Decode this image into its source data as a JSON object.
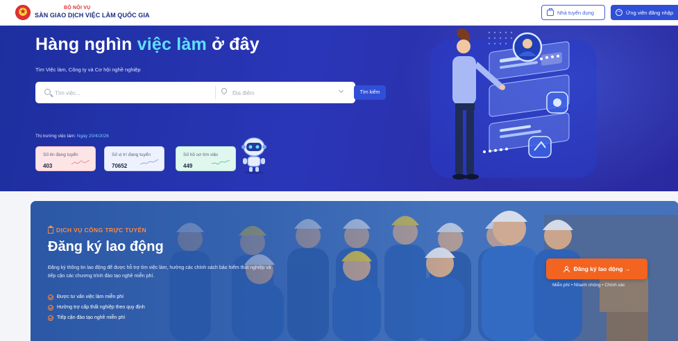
{
  "header": {
    "org_parent": "BỘ NỘI VỤ",
    "org_name": "SÀN GIAO DỊCH VIỆC LÀM QUỐC GIA",
    "employer_button": "Nhà tuyển dụng",
    "candidate_button": "Ứng viên đăng nhập"
  },
  "hero": {
    "title_prefix": "Hàng nghìn ",
    "title_highlight": "việc làm",
    "title_suffix": " ở đây",
    "subtitle": "Tìm Việc làm, Công ty và Cơ hội nghề nghiệp",
    "search": {
      "keyword_placeholder": "Tìm việc...",
      "location_placeholder": "Địa điểm",
      "button": "Tìm kiếm"
    },
    "market_label": "Thị trường việc làm: ",
    "market_date": "Ngày 20/4/2026",
    "stats": [
      {
        "label": "Số tin đang tuyển",
        "value": "403"
      },
      {
        "label": "Số vị trí đang tuyển",
        "value": "70652"
      },
      {
        "label": "Số hồ sơ tìm việc",
        "value": "449"
      }
    ]
  },
  "banner": {
    "tag": "DỊCH VỤ CÔNG TRỰC TUYẾN",
    "title": "Đăng ký lao động",
    "description": "Đăng ký thông tin lao động để được hỗ trợ tìm việc làm, hưởng các chính sách bảo hiểm thất nghiệp và tiếp cận các chương trình đào tạo nghề miễn phí.",
    "benefits": [
      "Được tư vấn việc làm miễn phí",
      "Hưởng trợ cấp thất nghiệp theo quy định",
      "Tiếp cận đào tạo nghề miễn phí"
    ],
    "cta": "Đăng ký lao động →",
    "note": "Miễn phí • Nhanh chóng • Chính xác"
  },
  "colors": {
    "primary": "#2f4fd6",
    "hero_bg": "#2a36b8",
    "highlight": "#5ee0ff",
    "accent_orange": "#f2641f",
    "org_red": "#e03131"
  }
}
